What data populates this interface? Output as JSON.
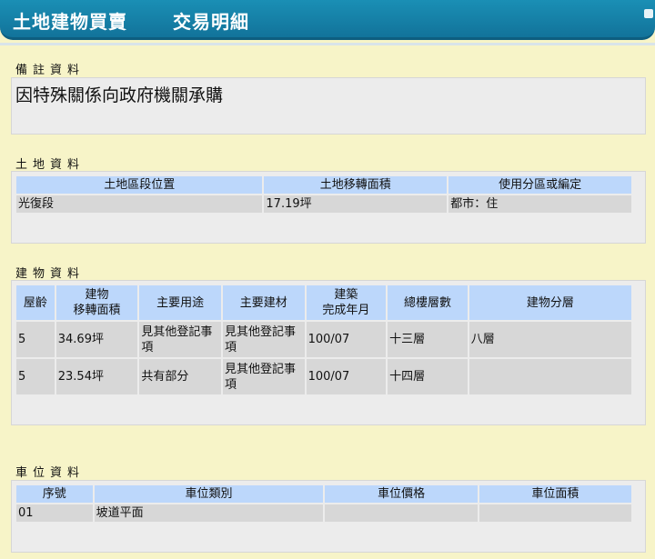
{
  "header": {
    "title": "土地建物買賣",
    "subtitle": "交易明細"
  },
  "note": {
    "title": "備註資料",
    "text": "因特殊關係向政府機關承購"
  },
  "land": {
    "title": "土地資料",
    "columns": [
      "土地區段位置",
      "土地移轉面積",
      "使用分區或編定"
    ],
    "rows": [
      [
        "光復段",
        "17.19坪",
        "都市：住"
      ]
    ]
  },
  "building": {
    "title": "建物資料",
    "columns": {
      "age": "屋齡",
      "area": "建物\n移轉面積",
      "use": "主要用途",
      "material": "主要建材",
      "completed": "建築\n完成年月",
      "floors": "總樓層數",
      "level": "建物分層"
    },
    "rows": [
      [
        "5",
        "34.69坪",
        "見其他登記事項",
        "見其他登記事項",
        "100/07",
        "十三層",
        "八層"
      ],
      [
        "5",
        "23.54坪",
        "共有部分",
        "見其他登記事項",
        "100/07",
        "十四層",
        ""
      ]
    ]
  },
  "parking": {
    "title": "車位資料",
    "columns": [
      "序號",
      "車位類別",
      "車位價格",
      "車位面積"
    ],
    "rows": [
      [
        "01",
        "坡道平面",
        "",
        ""
      ]
    ]
  }
}
